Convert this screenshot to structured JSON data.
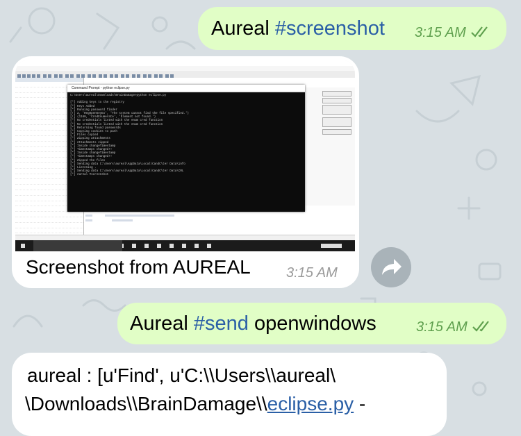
{
  "messages": [
    {
      "type": "outgoing",
      "parts": [
        {
          "text": "Aureal ",
          "tag": false
        },
        {
          "text": "#screenshot",
          "tag": true
        }
      ],
      "time": "3:15 AM",
      "status": "read"
    },
    {
      "type": "incoming",
      "caption": "Screenshot from AUREAL",
      "time": "3:15 AM"
    },
    {
      "type": "outgoing",
      "parts": [
        {
          "text": "Aureal ",
          "tag": false
        },
        {
          "text": "#send",
          "tag": true
        },
        {
          "text": " openwindows",
          "tag": false
        }
      ],
      "time": "3:15 AM",
      "status": "read"
    },
    {
      "type": "incoming",
      "line1": "aureal : [u'Find', u'C:\\\\Users\\\\aureal\\",
      "line2_pre": "\\Downloads\\\\BrainDamage\\\\",
      "line2_link": "eclipse.py",
      "line2_post": " -"
    }
  ],
  "screenshot": {
    "cmd_title": "Command Prompt - python eclipse.py",
    "cmd_lines": [
      "C:\\Users\\aureal\\Downloads\\BrainDamage>python eclipse.py",
      "",
      "[*] Adding keys to the registry",
      "[*] Keys Added",
      "[*] Running password finder",
      "[!] 2, 'RegOpenKeyEx', 'The system cannot find the file specified.')",
      "[!] (1168, 'CredEnumerate', 'Element not found.')",
      "[*] No credentials listed with the enum cred function",
      "[*] No credentials listed with the enum cred function",
      "[*] Returning found passwords",
      "[*] Copying cookies to path",
      "[*] Files copied",
      "[*] Zipping attachments",
      "[*] Attachments zipped",
      "[*] Inside changeTimestamp",
      "[*] Timestamps changed!!",
      "[*] Inside changeTimestamp",
      "[*] Timestamps changed!!",
      "[*] Zipped the files",
      "[*] Sending data C:\\Users\\aureal\\AppData\\Local\\CandC\\ter Data\\info",
      "[*] Listening .",
      "[*] Sending data C:\\Users\\aureal\\AppData\\Local\\CandC\\ter Data\\CRL",
      "[*] Aureal #screenshot"
    ]
  },
  "colors": {
    "outgoing_bubble": "#e1fec6",
    "incoming_bubble": "#ffffff",
    "hashtag": "#2a5fa6",
    "outgoing_time": "#5fa04e",
    "incoming_time": "#9a9a9a",
    "background": "#d8dfe3"
  },
  "icons": {
    "forward": "forward-arrow-icon",
    "read_status": "double-check-icon"
  }
}
